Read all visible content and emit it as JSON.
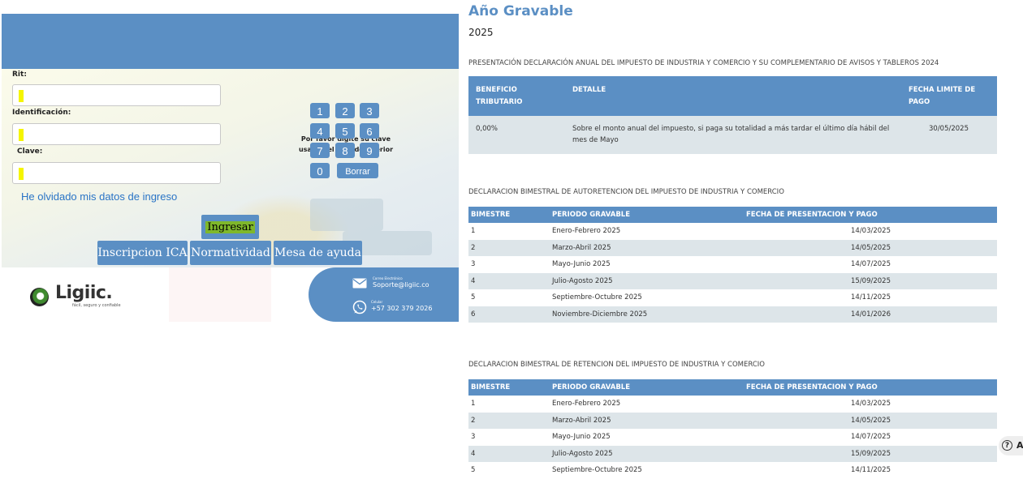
{
  "login": {
    "rit_label": "Rit:",
    "id_label": "Identificación:",
    "clave_label": "Clave:",
    "pad_title": "Por favor digite su clave usando el teclado inferior",
    "keys": [
      "1",
      "2",
      "3",
      "4",
      "5",
      "6",
      "7",
      "8",
      "9",
      "0"
    ],
    "delete_label": "Borrar",
    "forgot_link": "He olvidado mis datos de ingreso",
    "submit_label": "Ingresar",
    "nav_buttons": [
      "Inscripcion ICA",
      "Normatividad",
      "Mesa de ayuda"
    ]
  },
  "footer": {
    "logo_text": "Ligiic.",
    "logo_tagline": "fácil, seguro y confiable",
    "email_caption": "Correo Electrónico",
    "email": "Soporte@ligiic.co",
    "phone_caption": "Celular",
    "phone": "+57 302 379 2026"
  },
  "content": {
    "title": "Año Gravable",
    "year": "2025",
    "annual_section": {
      "title": "PRESENTACIÓN DECLARACIÓN ANUAL DEL IMPUESTO DE INDUSTRIA Y COMERCIO Y SU COMPLEMENTARIO DE AVISOS Y TABLEROS 2024",
      "headers": [
        "BENEFICIO TRIBUTARIO",
        "DETALLE",
        "FECHA LIMITE DE PAGO"
      ],
      "row": {
        "beneficio": "0,00%",
        "detalle": "Sobre el monto anual del impuesto, si paga su totalidad a más tardar el último día hábil del mes de Mayo",
        "fecha": "30/05/2025"
      }
    },
    "autoretencion_section": {
      "title": "DECLARACION BIMESTRAL DE AUTORETENCION DEL IMPUESTO DE INDUSTRIA Y COMERCIO",
      "headers": [
        "BIMESTRE",
        "PERIODO GRAVABLE",
        "FECHA DE PRESENTACION Y PAGO"
      ],
      "rows": [
        [
          "1",
          "Enero-Febrero 2025",
          "14/03/2025"
        ],
        [
          "2",
          "Marzo-Abril 2025",
          "14/05/2025"
        ],
        [
          "3",
          "Mayo-Junio 2025",
          "14/07/2025"
        ],
        [
          "4",
          "Julio-Agosto 2025",
          "15/09/2025"
        ],
        [
          "5",
          "Septiembre-Octubre 2025",
          "14/11/2025"
        ],
        [
          "6",
          "Noviembre-Diciembre 2025",
          "14/01/2026"
        ]
      ]
    },
    "retencion_section": {
      "title": "DECLARACION BIMESTRAL DE RETENCION DEL IMPUESTO DE INDUSTRIA Y COMERCIO",
      "headers": [
        "BIMESTRE",
        "PERIODO GRAVABLE",
        "FECHA DE PRESENTACION Y PAGO"
      ],
      "rows": [
        [
          "1",
          "Enero-Febrero 2025",
          "14/03/2025"
        ],
        [
          "2",
          "Marzo-Abril 2025",
          "14/05/2025"
        ],
        [
          "3",
          "Mayo-Junio 2025",
          "14/07/2025"
        ],
        [
          "4",
          "Julio-Agosto 2025",
          "15/09/2025"
        ],
        [
          "5",
          "Septiembre-Octubre 2025",
          "14/11/2025"
        ]
      ]
    }
  },
  "help_button": {
    "icon": "question-icon",
    "label": "A"
  },
  "colors": {
    "brand_blue": "#5b8fc4",
    "row_stripe": "#dde5e9",
    "link": "#2a74c6",
    "highlight": "#7fb82b"
  }
}
